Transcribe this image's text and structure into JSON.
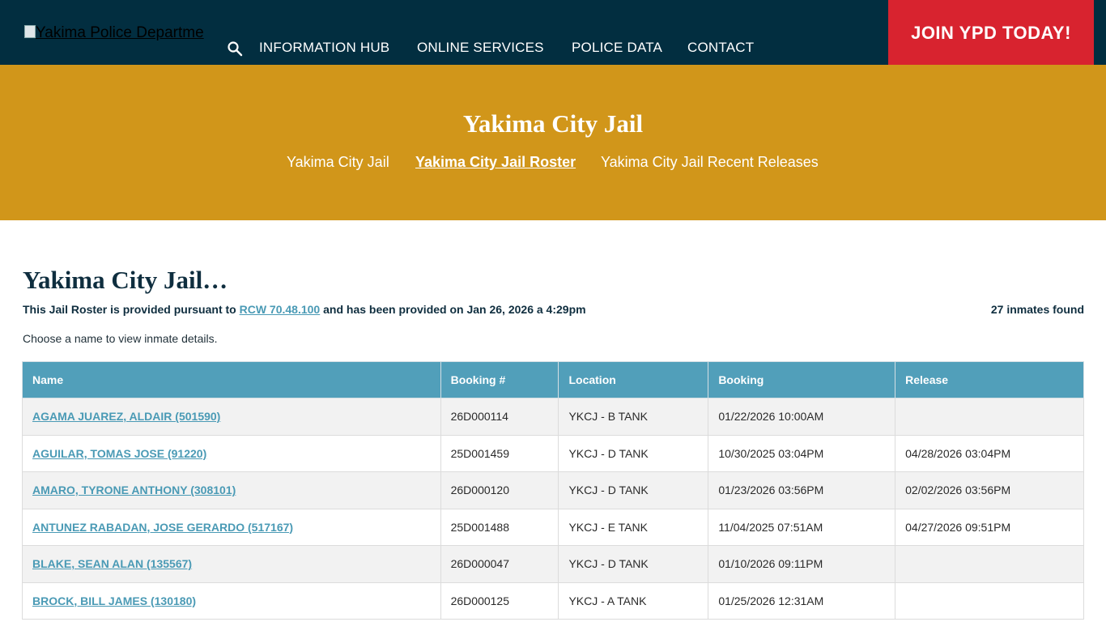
{
  "header": {
    "logo_alt": "Yakima Police Departme",
    "nav": [
      {
        "label": "INFORMATION HUB"
      },
      {
        "label": "ONLINE SERVICES"
      },
      {
        "label": "POLICE DATA"
      },
      {
        "label": "CONTACT"
      }
    ],
    "cta_label": "JOIN YPD TODAY!"
  },
  "hero": {
    "title": "Yakima City Jail",
    "subnav": [
      {
        "label": "Yakima City Jail"
      },
      {
        "label": "Yakima City Jail Roster"
      },
      {
        "label": "Yakima City Jail Recent Releases"
      }
    ]
  },
  "main": {
    "title": "Yakima City Jail…",
    "notice_prefix": "This Jail Roster is provided pursuant to ",
    "notice_link": "RCW 70.48.100",
    "notice_suffix": " and has been provided on Jan 26, 2026 a 4:29pm",
    "inmate_count": "27 inmates found",
    "instructions": "Choose a name to view inmate details."
  },
  "table": {
    "columns": [
      "Name",
      "Booking #",
      "Location",
      "Booking",
      "Release"
    ],
    "rows": [
      {
        "name": "AGAMA JUAREZ, ALDAIR (501590)",
        "booking_no": "26D000114",
        "location": "YKCJ - B TANK",
        "booking": "01/22/2026 10:00AM",
        "release": ""
      },
      {
        "name": "AGUILAR, TOMAS JOSE (91220)",
        "booking_no": "25D001459",
        "location": "YKCJ - D TANK",
        "booking": "10/30/2025 03:04PM",
        "release": "04/28/2026 03:04PM"
      },
      {
        "name": "AMARO, TYRONE ANTHONY (308101)",
        "booking_no": "26D000120",
        "location": "YKCJ - D TANK",
        "booking": "01/23/2026 03:56PM",
        "release": "02/02/2026 03:56PM"
      },
      {
        "name": "ANTUNEZ RABADAN, JOSE GERARDO (517167)",
        "booking_no": "25D001488",
        "location": "YKCJ - E TANK",
        "booking": "11/04/2025 07:51AM",
        "release": "04/27/2026 09:51PM"
      },
      {
        "name": "BLAKE, SEAN ALAN (135567)",
        "booking_no": "26D000047",
        "location": "YKCJ - D TANK",
        "booking": "01/10/2026 09:11PM",
        "release": ""
      },
      {
        "name": "BROCK, BILL JAMES (130180)",
        "booking_no": "26D000125",
        "location": "YKCJ - A TANK",
        "booking": "01/25/2026 12:31AM",
        "release": ""
      }
    ]
  },
  "colors": {
    "topbar": "#022e40",
    "cta": "#d8232f",
    "hero": "#d1961a",
    "table_header": "#519fba",
    "link": "#4a9ab5"
  }
}
